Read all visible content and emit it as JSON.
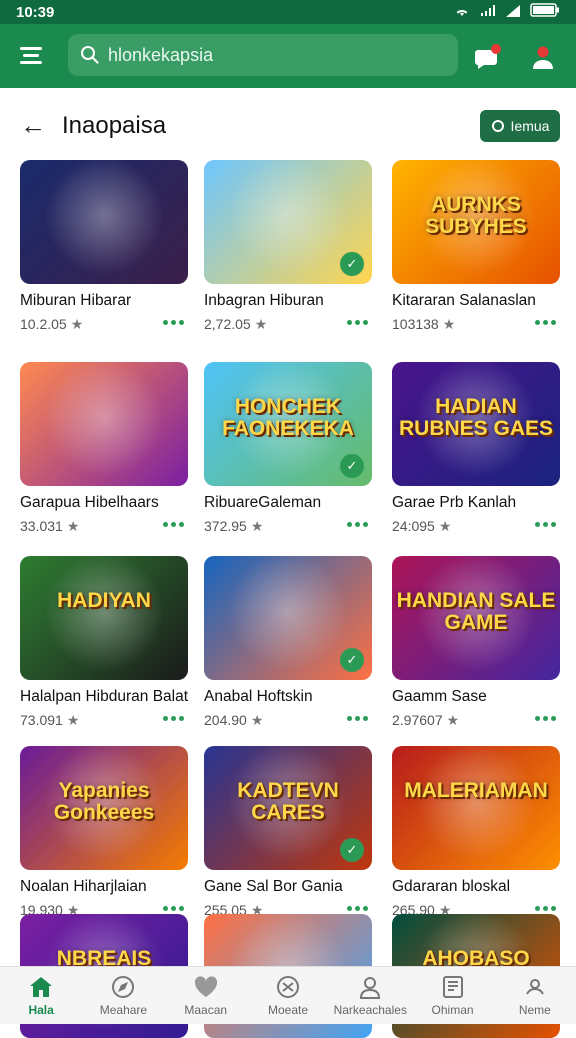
{
  "status": {
    "time": "10:39"
  },
  "header": {
    "search_text": "hlonkekapsia"
  },
  "subheader": {
    "title": "Inaopaisa",
    "filter_label": "Iemua"
  },
  "cards": [
    {
      "title": "Miburan Hibarar",
      "meta": "10.2.05",
      "art_text": "",
      "colors": [
        "#1a2a6c",
        "#3b1f4a"
      ]
    },
    {
      "title": "Inbagran Hiburan",
      "meta": "2,72.05",
      "art_text": "",
      "colors": [
        "#6ec6ff",
        "#ffd54f"
      ]
    },
    {
      "title": "Kitararan Salanaslan",
      "meta": "103138",
      "art_text": "AURNKS SUBYHES",
      "colors": [
        "#ffb300",
        "#e65100"
      ]
    },
    {
      "title": "Garapua Hibelhaars",
      "meta": "33.031",
      "art_text": "",
      "colors": [
        "#ff8a50",
        "#7b1fa2"
      ]
    },
    {
      "title": "RibuareGaleman",
      "meta": "372.95",
      "art_text": "HONCHEK FAONEKEKA",
      "colors": [
        "#4fc3f7",
        "#66bb6a"
      ]
    },
    {
      "title": "Garae Prb Kanlah",
      "meta": "24:095",
      "art_text": "HADIAN RUBNES GAES",
      "colors": [
        "#4a148c",
        "#1a237e"
      ]
    },
    {
      "title": "Halalpan Hibduran Balat",
      "meta": "73.091",
      "art_text": "HADIYAN",
      "colors": [
        "#2e7d32",
        "#1b1b1b"
      ]
    },
    {
      "title": "Anabal Hoftskin",
      "meta": "204.90",
      "art_text": "",
      "colors": [
        "#1565c0",
        "#ff7043"
      ]
    },
    {
      "title": "Gaamm Sase",
      "meta": "2.97607",
      "art_text": "HANDIAN SALE GAME",
      "colors": [
        "#ad1457",
        "#4527a0"
      ]
    },
    {
      "title": "Noalan Hiharjlaian",
      "meta": "19.930",
      "art_text": "Yapanies Gonkeees",
      "colors": [
        "#6a1b9a",
        "#f57c00"
      ]
    },
    {
      "title": "Gane Sal Bor Gania",
      "meta": "255.05",
      "art_text": "KADTEVN CARES",
      "colors": [
        "#283593",
        "#bf360c"
      ]
    },
    {
      "title": "Gdararan bloskal",
      "meta": "265.90",
      "art_text": "MALERIAMAN",
      "colors": [
        "#b71c1c",
        "#ff8f00"
      ]
    },
    {
      "title": "",
      "meta": "",
      "art_text": "NBREAIS",
      "colors": [
        "#7b1fa2",
        "#311b92"
      ]
    },
    {
      "title": "",
      "meta": "",
      "art_text": "",
      "colors": [
        "#ff7043",
        "#42a5f5"
      ]
    },
    {
      "title": "",
      "meta": "",
      "art_text": "AHOBASO",
      "colors": [
        "#004d40",
        "#e65100"
      ]
    }
  ],
  "bottom_nav": [
    {
      "label": "Hala",
      "icon": "home-icon",
      "active": true
    },
    {
      "label": "Meahare",
      "icon": "explore-icon",
      "active": false
    },
    {
      "label": "Maacan",
      "icon": "heart-icon",
      "active": false
    },
    {
      "label": "Moeate",
      "icon": "game-icon",
      "active": false
    },
    {
      "label": "Narkeachales",
      "icon": "person-icon",
      "active": false
    },
    {
      "label": "Ohiman",
      "icon": "library-icon",
      "active": false
    },
    {
      "label": "Neme",
      "icon": "profile-icon",
      "active": false
    }
  ],
  "colors": {
    "brand": "#1b8a4e",
    "accent": "#2a9a55"
  }
}
